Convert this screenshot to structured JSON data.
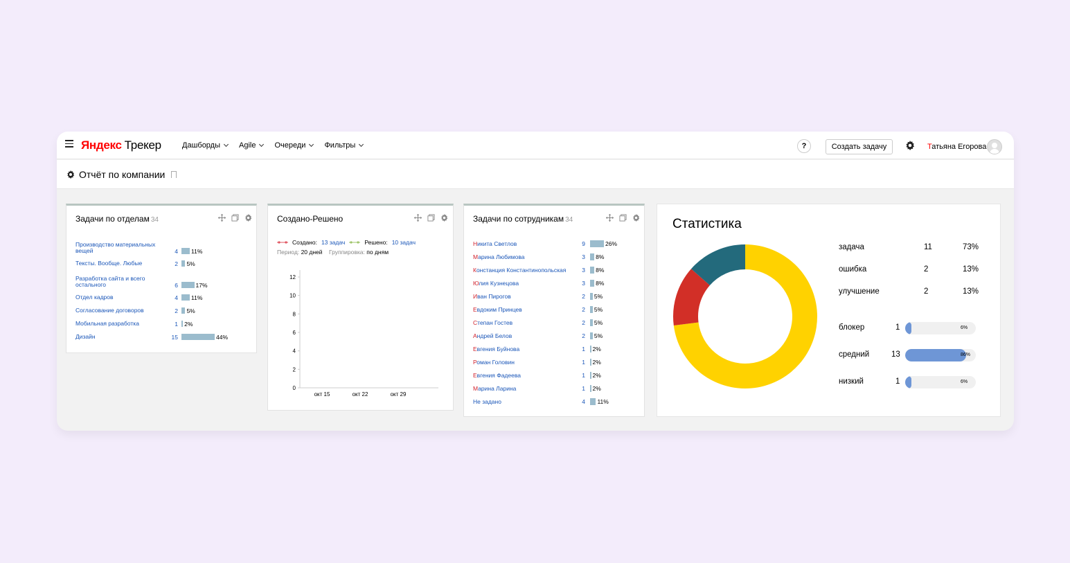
{
  "header": {
    "logo_brand": "Яндекс",
    "logo_product": "Трекер",
    "nav": [
      {
        "label": "Дашборды"
      },
      {
        "label": "Agile"
      },
      {
        "label": "Очереди"
      },
      {
        "label": "Фильтры"
      }
    ],
    "help_label": "?",
    "create_label": "Создать задачу",
    "user_first": "Т",
    "user_rest": "атьяна Егорова"
  },
  "page": {
    "title": "Отчёт по компании"
  },
  "departments_widget": {
    "title": "Задачи по отделам",
    "count": "34",
    "rows": [
      {
        "name": "Производство материальных вещей",
        "count": "4",
        "pct": "11%",
        "share": 0.11
      },
      {
        "name": "Тексты. Вообще. Любые",
        "count": "2",
        "pct": "5%",
        "share": 0.05
      },
      {
        "name": "Разработка сайта и всего остального",
        "count": "6",
        "pct": "17%",
        "share": 0.17
      },
      {
        "name": "Отдел кадров",
        "count": "4",
        "pct": "11%",
        "share": 0.11
      },
      {
        "name": "Согласование договоров",
        "count": "2",
        "pct": "5%",
        "share": 0.05
      },
      {
        "name": "Мобильная разработка",
        "count": "1",
        "pct": "2%",
        "share": 0.02
      },
      {
        "name": "Дизайн",
        "count": "15",
        "pct": "44%",
        "share": 0.44
      }
    ]
  },
  "created_resolved_widget": {
    "title": "Создано-Решено",
    "created_label": "Создано:",
    "created_value": "13 задач",
    "resolved_label": "Решено:",
    "resolved_value": "10 задач",
    "period_label": "Период:",
    "period_value": "20 дней",
    "group_label": "Группировка:",
    "group_value": "по дням",
    "created_color": "#e05561",
    "resolved_color": "#9fc46a"
  },
  "chart_data": {
    "type": "line",
    "x_ticks": [
      "окт 15",
      "окт 22",
      "окт 29"
    ],
    "y_ticks": [
      "0",
      "2",
      "4",
      "6",
      "8",
      "10",
      "12"
    ],
    "ylim": [
      0,
      12
    ],
    "series": [
      {
        "name": "Создано",
        "values": []
      },
      {
        "name": "Решено",
        "values": []
      }
    ]
  },
  "employees_widget": {
    "title": "Задачи по сотрудникам",
    "count": "34",
    "rows": [
      {
        "first": "Н",
        "rest": "икита Светлов",
        "count": "9",
        "pct": "26%",
        "share": 0.26
      },
      {
        "first": "М",
        "rest": "арина Любимова",
        "count": "3",
        "pct": "8%",
        "share": 0.08
      },
      {
        "first": "К",
        "rest": "онстанция Константинопольская",
        "count": "3",
        "pct": "8%",
        "share": 0.08
      },
      {
        "first": "Ю",
        "rest": "лия Кузнецова",
        "count": "3",
        "pct": "8%",
        "share": 0.08
      },
      {
        "first": "И",
        "rest": "ван Пирогов",
        "count": "2",
        "pct": "5%",
        "share": 0.05
      },
      {
        "first": "Е",
        "rest": "вдоким Принцев",
        "count": "2",
        "pct": "5%",
        "share": 0.05
      },
      {
        "first": "С",
        "rest": "тепан Гостев",
        "count": "2",
        "pct": "5%",
        "share": 0.05
      },
      {
        "first": "А",
        "rest": "ндрей Белов",
        "count": "2",
        "pct": "5%",
        "share": 0.05
      },
      {
        "first": "Е",
        "rest": "вгения Буйнова",
        "count": "1",
        "pct": "2%",
        "share": 0.02
      },
      {
        "first": "Р",
        "rest": "оман Головин",
        "count": "1",
        "pct": "2%",
        "share": 0.02
      },
      {
        "first": "Е",
        "rest": "вгения Фадеева",
        "count": "1",
        "pct": "2%",
        "share": 0.02
      },
      {
        "first": "М",
        "rest": "арина Ларина",
        "count": "1",
        "pct": "2%",
        "share": 0.02
      },
      {
        "first": "",
        "rest": "Не задано",
        "count": "4",
        "pct": "11%",
        "share": 0.11
      }
    ]
  },
  "stats_widget": {
    "title": "Статистика",
    "types": [
      {
        "label": "задача",
        "count": "11",
        "pct": "73%",
        "share": 0.73,
        "color": "#ffd200"
      },
      {
        "label": "ошибка",
        "count": "2",
        "pct": "13%",
        "share": 0.135,
        "color": "#d22f27"
      },
      {
        "label": "улучшение",
        "count": "2",
        "pct": "13%",
        "share": 0.135,
        "color": "#236a7c"
      }
    ],
    "priorities": [
      {
        "label": "блокер",
        "count": "1",
        "pct": "6%",
        "share": 0.06
      },
      {
        "label": "средний",
        "count": "13",
        "pct": "86%",
        "share": 0.86
      },
      {
        "label": "низкий",
        "count": "1",
        "pct": "6%",
        "share": 0.06
      }
    ]
  }
}
